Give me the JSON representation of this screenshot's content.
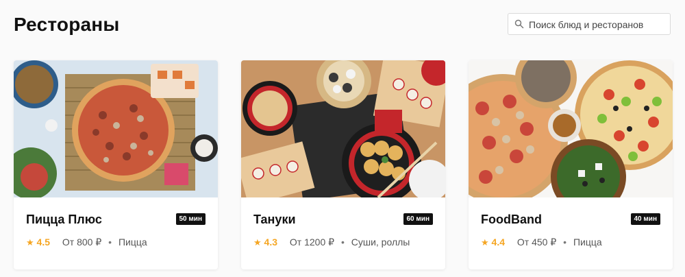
{
  "page": {
    "title": "Рестораны"
  },
  "search": {
    "placeholder": "Поиск блюд и ресторанов",
    "icon": "search-icon"
  },
  "colors": {
    "rating": "#f5a623",
    "badge_bg": "#111111"
  },
  "restaurants": [
    {
      "name": "Пицца Плюс",
      "time": "50 мин",
      "rating": "4.5",
      "price": "От 800 ₽",
      "cuisine": "Пицца"
    },
    {
      "name": "Тануки",
      "time": "60 мин",
      "rating": "4.3",
      "price": "От 1200 ₽",
      "cuisine": "Суши, роллы"
    },
    {
      "name": "FoodBand",
      "time": "40 мин",
      "rating": "4.4",
      "price": "От 450 ₽",
      "cuisine": "Пицца"
    }
  ]
}
